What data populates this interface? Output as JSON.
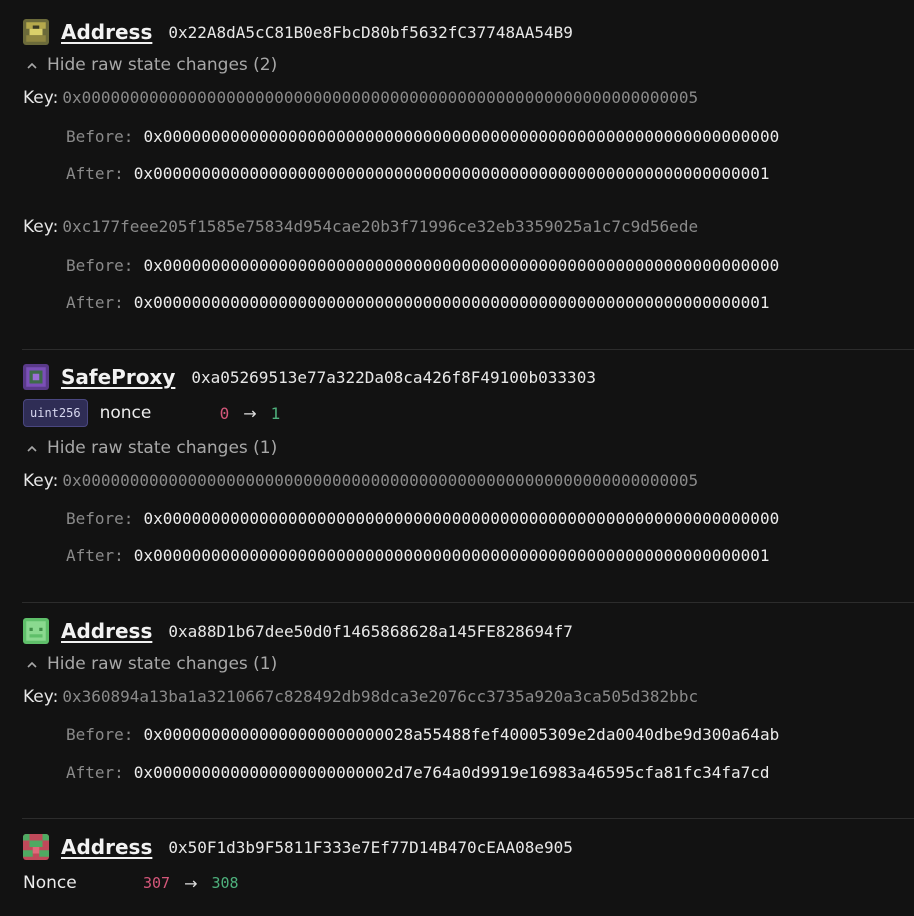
{
  "accounts": [
    {
      "label": "Address",
      "address": "0x22A8dA5cC81B0e8FbcD80bf5632fC37748AA54B9",
      "avatar_icon": "identicon-olive",
      "raw_toggle": "Hide raw state changes (2)",
      "raw_changes": [
        {
          "key_label": "Key:",
          "key": "0x0000000000000000000000000000000000000000000000000000000000000005",
          "before_label": "Before:",
          "before": "0x0000000000000000000000000000000000000000000000000000000000000000",
          "after_label": "After:",
          "after": "0x0000000000000000000000000000000000000000000000000000000000000001"
        },
        {
          "key_label": "Key:",
          "key": "0xc177feee205f1585e75834d954cae20b3f71996ce32eb3359025a1c7c9d56ede",
          "before_label": "Before:",
          "before": "0x0000000000000000000000000000000000000000000000000000000000000000",
          "after_label": "After:",
          "after": "0x0000000000000000000000000000000000000000000000000000000000000001"
        }
      ]
    },
    {
      "label": "SafeProxy",
      "address": "0xa05269513e77a322Da08ca426f8F49100b033303",
      "avatar_icon": "identicon-purple",
      "decoded": {
        "type": "uint256",
        "name": "nonce",
        "old": "0",
        "new": "1"
      },
      "raw_toggle": "Hide raw state changes (1)",
      "raw_changes": [
        {
          "key_label": "Key:",
          "key": "0x0000000000000000000000000000000000000000000000000000000000000005",
          "before_label": "Before:",
          "before": "0x0000000000000000000000000000000000000000000000000000000000000000",
          "after_label": "After:",
          "after": "0x0000000000000000000000000000000000000000000000000000000000000001"
        }
      ]
    },
    {
      "label": "Address",
      "address": "0xa88D1b67dee50d0f1465868628a145FE828694f7",
      "avatar_icon": "identicon-green",
      "raw_toggle": "Hide raw state changes (1)",
      "raw_changes": [
        {
          "key_label": "Key:",
          "key": "0x360894a13ba1a3210667c828492db98dca3e2076cc3735a920a3ca505d382bbc",
          "before_label": "Before:",
          "before": "0x00000000000000000000000028a55488fef40005309e2da0040dbe9d300a64ab",
          "after_label": "After:",
          "after": "0x0000000000000000000000002d7e764a0d9919e16983a46595cfa81fc34fa7cd"
        }
      ]
    },
    {
      "label": "Address",
      "address": "0x50F1d3b9F5811F333e7Ef77D14B470cEAA08e905",
      "avatar_icon": "identicon-red-green",
      "nonce": {
        "label": "Nonce",
        "old": "307",
        "new": "308"
      }
    }
  ],
  "colors": {
    "background": "#121212",
    "old_value": "#d4577a",
    "new_value": "#4eb07c",
    "badge_bg": "#2f2d55"
  }
}
